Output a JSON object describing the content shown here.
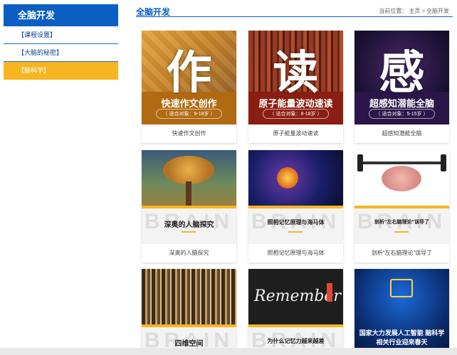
{
  "sidebar": {
    "title": "全脑开发",
    "items": [
      {
        "label": "【课程设置】"
      },
      {
        "label": "【大脑的秘密】"
      },
      {
        "label": "【脑科学】"
      }
    ]
  },
  "header": {
    "title": "全脑开发",
    "breadcrumb_prefix": "当前位置：",
    "breadcrumb": [
      "主页",
      ">",
      "全脑开发"
    ]
  },
  "cards": [
    {
      "big": "作",
      "strip_title": "快速作文创作",
      "strip_sub": "（ 适合对象：9-18岁 ）",
      "caption": "快速作文创作"
    },
    {
      "big": "读",
      "strip_title": "原子能量波动速读",
      "strip_sub": "（ 适合对象：8-18岁 ）",
      "caption": "原子能量波动速读"
    },
    {
      "big": "感",
      "strip_title": "超感知潜能全脑",
      "strip_sub": "（ 适合对象：5-15岁 ）",
      "caption": "超感知潜能全脑"
    },
    {
      "watermark": "BRAIN",
      "band_title": "深奥的人脑探究",
      "caption": "深奥的人脑探究"
    },
    {
      "watermark": "BRAIN",
      "band_title": "照相记忆原理与海马体",
      "caption": "照相记忆原理与海马体"
    },
    {
      "watermark": "BRAIN",
      "band_title": "剖析“左右脑理论”误导了",
      "caption": "剖析“左右脑理论”误导了"
    },
    {
      "watermark": "BRAIN",
      "band_title": "四维空间",
      "caption": ""
    },
    {
      "watermark": "BRAIN",
      "band_title": "为什么记忆力越来越差",
      "overlay": "Remember",
      "caption": ""
    },
    {
      "band_title": "国家大力发展人工智能 脑科学相关行业迎来春天",
      "caption": ""
    }
  ]
}
